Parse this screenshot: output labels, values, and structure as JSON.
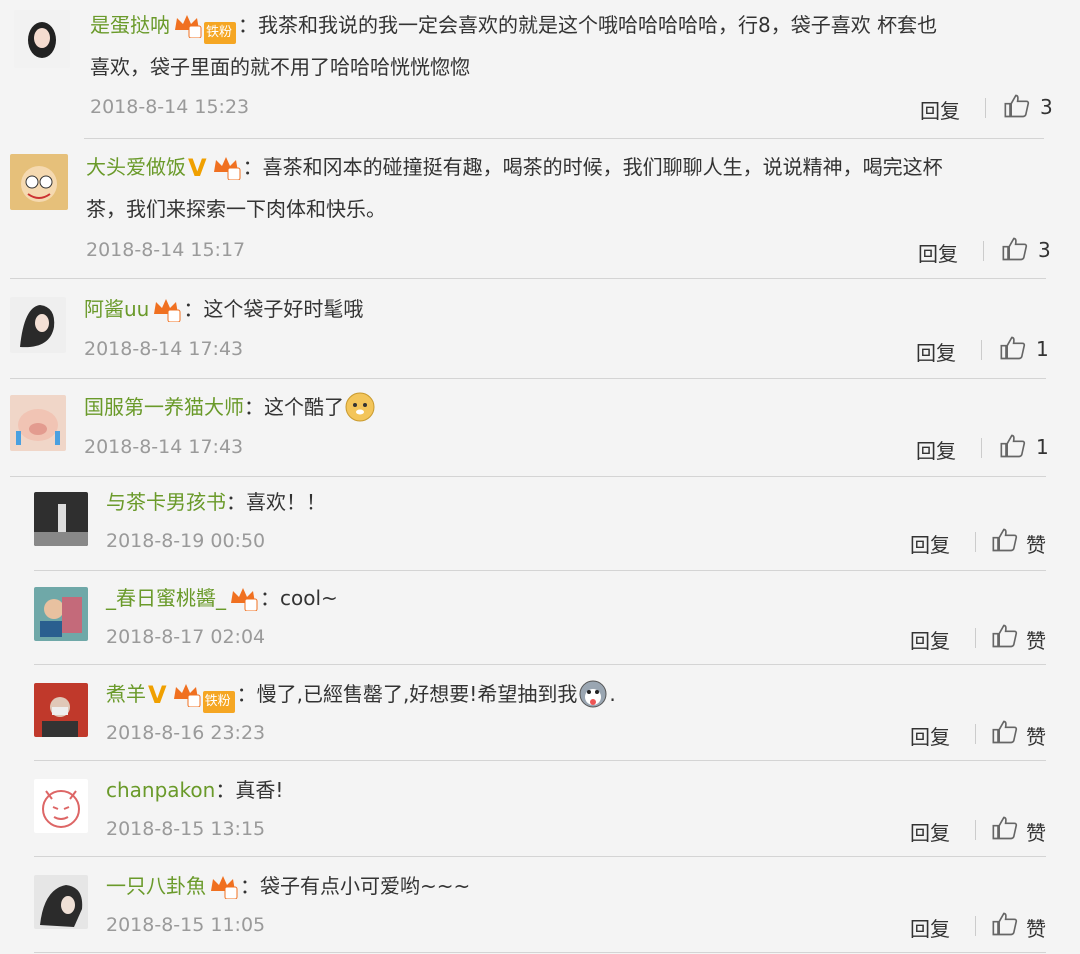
{
  "comments": [
    {
      "username": "是蛋挞呐",
      "badge": "铁粉",
      "text1": "：我茶和我说的我一定会喜欢的就是这个哦哈哈哈哈哈，行8，袋子喜欢 杯套也",
      "text2": "喜欢，袋子里面的就不用了哈哈哈恍恍惚惚",
      "time": "2018-8-14 15:23",
      "reply": "回复",
      "likes": "3",
      "avatar_color": "#e8e8e8"
    },
    {
      "username": "大头爱做饭",
      "badge": "",
      "text1": "：喜茶和冈本的碰撞挺有趣，喝茶的时候，我们聊聊人生，说说精神，喝完这杯",
      "text2": "茶，我们来探索一下肉体和快乐。",
      "time": "2018-8-14 15:17",
      "reply": "回复",
      "likes": "3",
      "avatar_color": "#e8b870"
    },
    {
      "username": "阿酱uu",
      "text1": "：这个袋子好时髦哦",
      "time": "2018-8-14 17:43",
      "reply": "回复",
      "likes": "1",
      "avatar_color": "#cfcfcf"
    },
    {
      "username": "国服第一养猫大师",
      "text1": "：这个酷了",
      "time": "2018-8-14 17:43",
      "reply": "回复",
      "likes": "1",
      "avatar_color": "#e9c9b9"
    },
    {
      "username": "与茶卡男孩书",
      "text1": "：喜欢！！",
      "time": "2018-8-19 00:50",
      "reply": "回复",
      "likes": "赞",
      "avatar_color": "#333"
    },
    {
      "username": "_春日蜜桃醬_",
      "text1": "：cool~",
      "time": "2018-8-17 02:04",
      "reply": "回复",
      "likes": "赞",
      "avatar_color": "#7aa"
    },
    {
      "username": "煮羊",
      "badge": "铁粉",
      "text1": "：慢了,已經售罄了,好想要!希望抽到我",
      "text1b": ".",
      "time": "2018-8-16 23:23",
      "reply": "回复",
      "likes": "赞",
      "avatar_color": "#b33"
    },
    {
      "username": "chanpakon",
      "text1": "：真香!",
      "time": "2018-8-15 13:15",
      "reply": "回复",
      "likes": "赞",
      "avatar_color": "#fff"
    },
    {
      "username": "一只八卦魚",
      "text1": "：袋子有点小可爱哟~~~",
      "time": "2018-8-15 11:05",
      "reply": "回复",
      "likes": "赞",
      "avatar_color": "#ddd"
    }
  ],
  "colors": {
    "username": "#6a9a2a",
    "time": "#9a9a9a",
    "background": "#f4f4f4"
  }
}
